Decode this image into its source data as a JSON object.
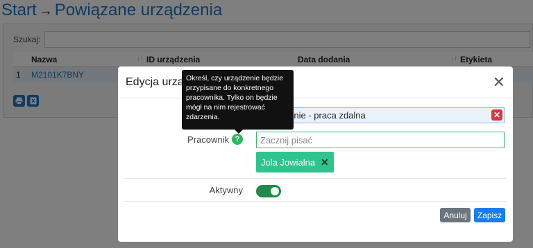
{
  "breadcrumb": {
    "home": "Start",
    "current": "Powiązane urządzenia"
  },
  "search": {
    "label": "Szukaj:",
    "value": ""
  },
  "table": {
    "columns": [
      "Nazwa",
      "ID urządzenia",
      "Data dodania",
      "Etykieta"
    ],
    "rows": [
      {
        "index": "1",
        "name": "M2101K7BNY"
      }
    ]
  },
  "toolbar": {
    "print_icon": "print-icon",
    "export_icon": "export-icon"
  },
  "modal": {
    "title": "Edycja urządzenia",
    "close_icon": "close-icon",
    "device_type_value": "Urządzenie - praca zdalna",
    "employee_label": "Pracownik",
    "employee_placeholder": "Zacznij pisać",
    "employee_chip": "Jola Jowialna",
    "active_label": "Aktywny",
    "active_value": true,
    "cancel_label": "Anuluj",
    "save_label": "Zapisz"
  },
  "tooltip": {
    "text": "Określ, czy urządzenie będzie przypisane do konkretnego pracownika. Tylko on będzie mógł na nim rejestrować zdarzenia."
  },
  "colors": {
    "accent": "#1f77c4",
    "success": "#2fc48d",
    "danger": "#d93843",
    "primary_button": "#1a7cef"
  }
}
